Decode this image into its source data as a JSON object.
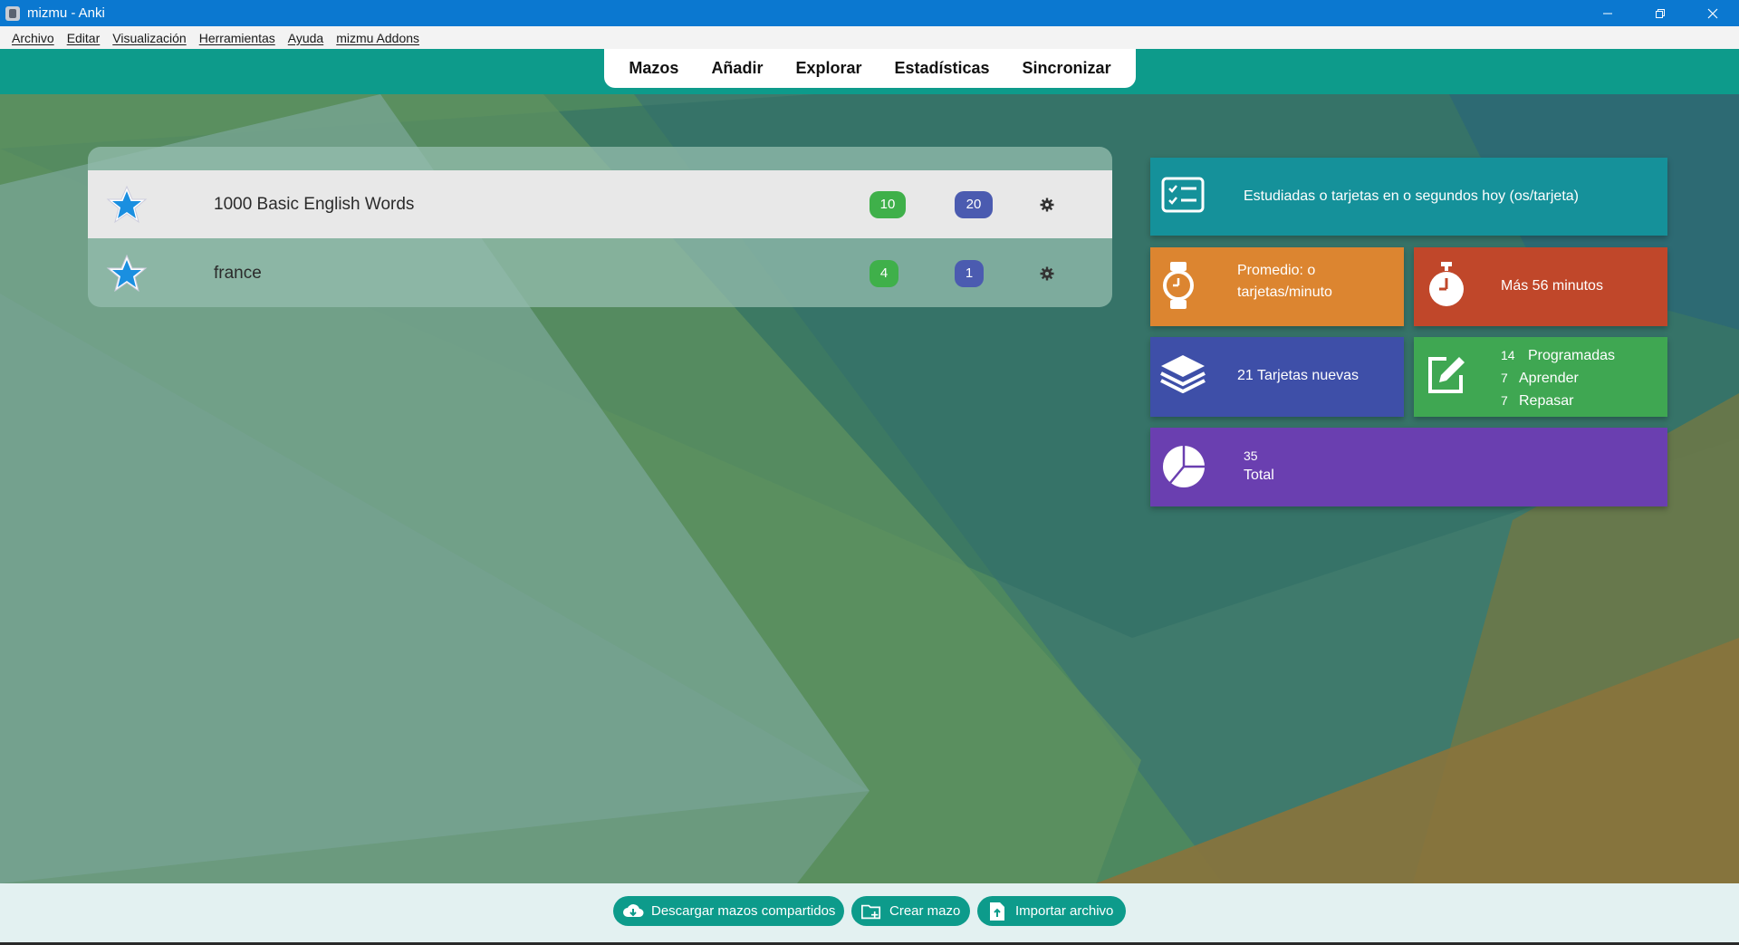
{
  "window": {
    "title": "mizmu - Anki",
    "controls": [
      "minimize-icon",
      "restore-icon",
      "close-icon"
    ]
  },
  "menu": {
    "items": [
      "Archivo",
      "Editar",
      "Visualización",
      "Herramientas",
      "Ayuda",
      "mizmu Addons"
    ]
  },
  "toolbar": {
    "links": [
      "Mazos",
      "Añadir",
      "Explorar",
      "Estadísticas",
      "Sincronizar"
    ]
  },
  "decks": [
    {
      "name": "1000 Basic English Words",
      "new": "10",
      "due": "20",
      "icon": "star-icon",
      "options_icon": "gear-icon"
    },
    {
      "name": "france",
      "new": "4",
      "due": "1",
      "icon": "star-icon",
      "options_icon": "gear-icon"
    }
  ],
  "stats": {
    "studied": {
      "text": "Estudiadas o tarjetas en o segundos hoy (os/tarjeta)",
      "icon": "checklist-icon",
      "color": "#15919a"
    },
    "average": {
      "line1": "Promedio: o",
      "line2": "tarjetas/minuto",
      "icon": "watch-icon",
      "color": "#dc8530"
    },
    "more": {
      "text": "Más 56 minutos",
      "icon": "stopwatch-icon",
      "color": "#c0472a"
    },
    "new_cards": {
      "text": "21 Tarjetas nuevas",
      "icon": "layers-icon",
      "color": "#3e4fa8"
    },
    "scheduled": {
      "rows": [
        {
          "count": "14",
          "label": "Programadas"
        },
        {
          "count": "7",
          "label": "Aprender"
        },
        {
          "count": "7",
          "label": "Repasar"
        }
      ],
      "icon": "edit-icon",
      "color": "#3fa752"
    },
    "total": {
      "count": "35",
      "label": "Total",
      "icon": "pie-chart-icon",
      "color": "#6a3fb0"
    }
  },
  "bottom": {
    "download": {
      "label": "Descargar mazos compartidos",
      "icon": "cloud-download-icon"
    },
    "create": {
      "label": "Crear mazo",
      "icon": "folder-add-icon"
    },
    "import": {
      "label": "Importar archivo",
      "icon": "file-upload-icon"
    }
  },
  "colors": {
    "titlebar": "#0b78d0",
    "accent": "#0d9b8b",
    "badge_new": "#3fb04a",
    "badge_due": "#4b5bb0"
  }
}
